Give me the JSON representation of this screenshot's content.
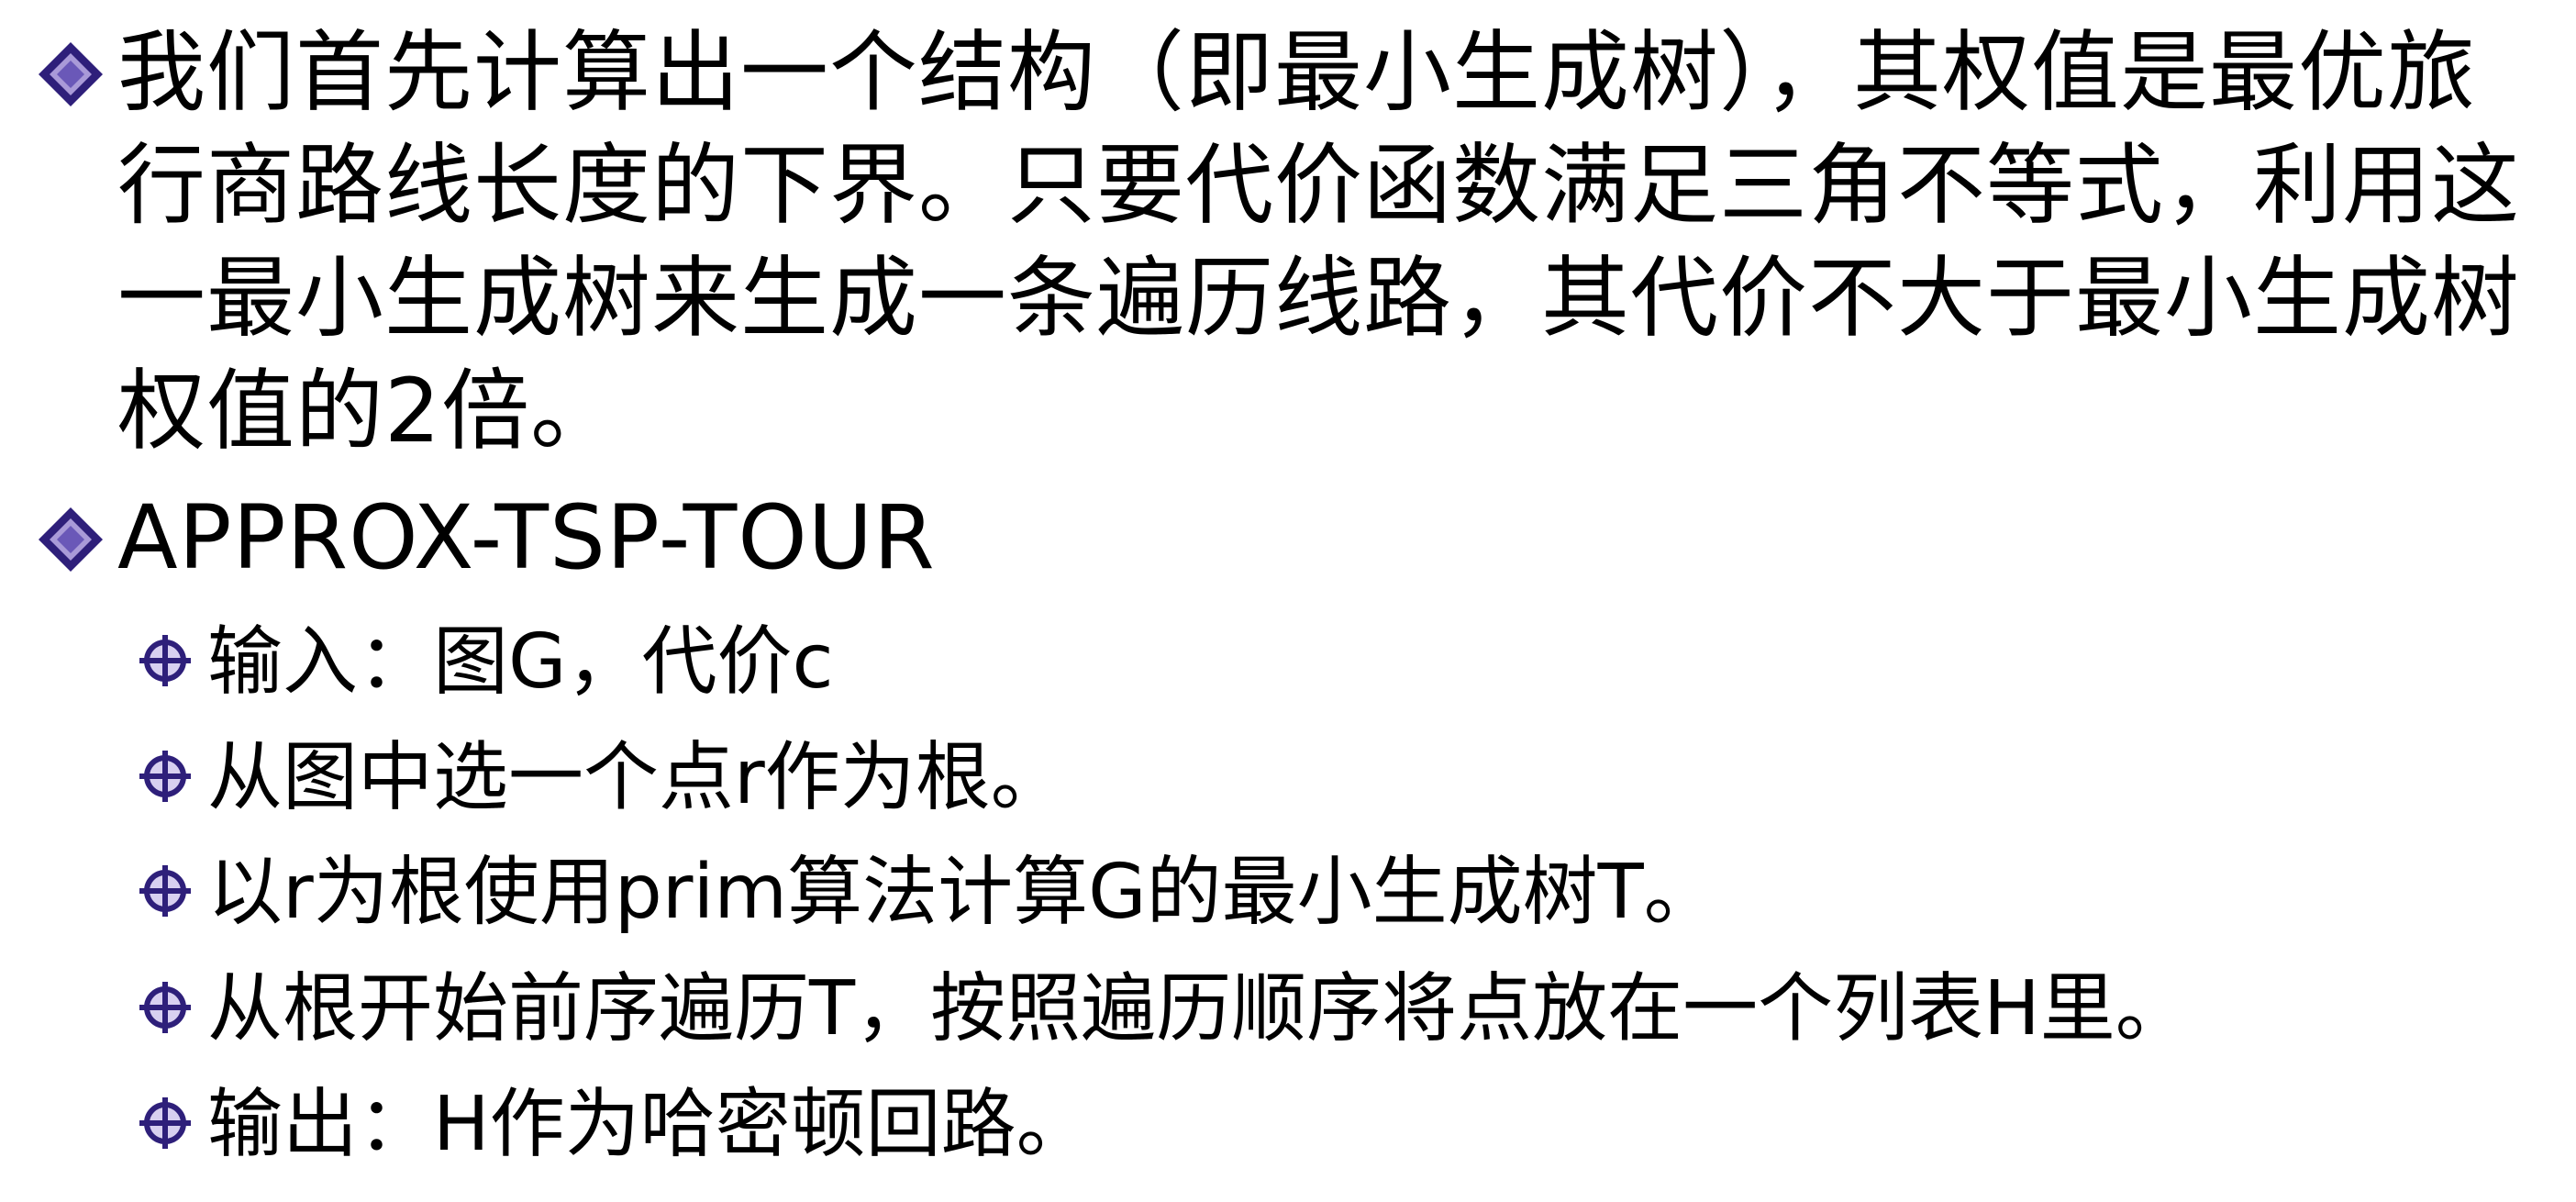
{
  "colors": {
    "bullet_primary": "#2e1f7a",
    "bullet_highlight": "#a99ad8",
    "text": "#000000"
  },
  "bullets": {
    "level1_icon": "diamond-bullet-icon",
    "level2_icon": "crosshair-bullet-icon"
  },
  "items": [
    {
      "text": "我们首先计算出一个结构（即最小生成树），其权值是最优旅行商路线长度的下界。只要代价函数满足三角不等式，利用这一最小生成树来生成一条遍历线路，其代价不大于最小生成树权值的2倍。"
    },
    {
      "text": "APPROX-TSP-TOUR"
    }
  ],
  "subitems": [
    {
      "text": "输入：图G，代价c"
    },
    {
      "text": "从图中选一个点r作为根。"
    },
    {
      "text": "以r为根使用prim算法计算G的最小生成树T。"
    },
    {
      "text": "从根开始前序遍历T，按照遍历顺序将点放在一个列表H里。"
    },
    {
      "text": "输出：H作为哈密顿回路。"
    }
  ]
}
